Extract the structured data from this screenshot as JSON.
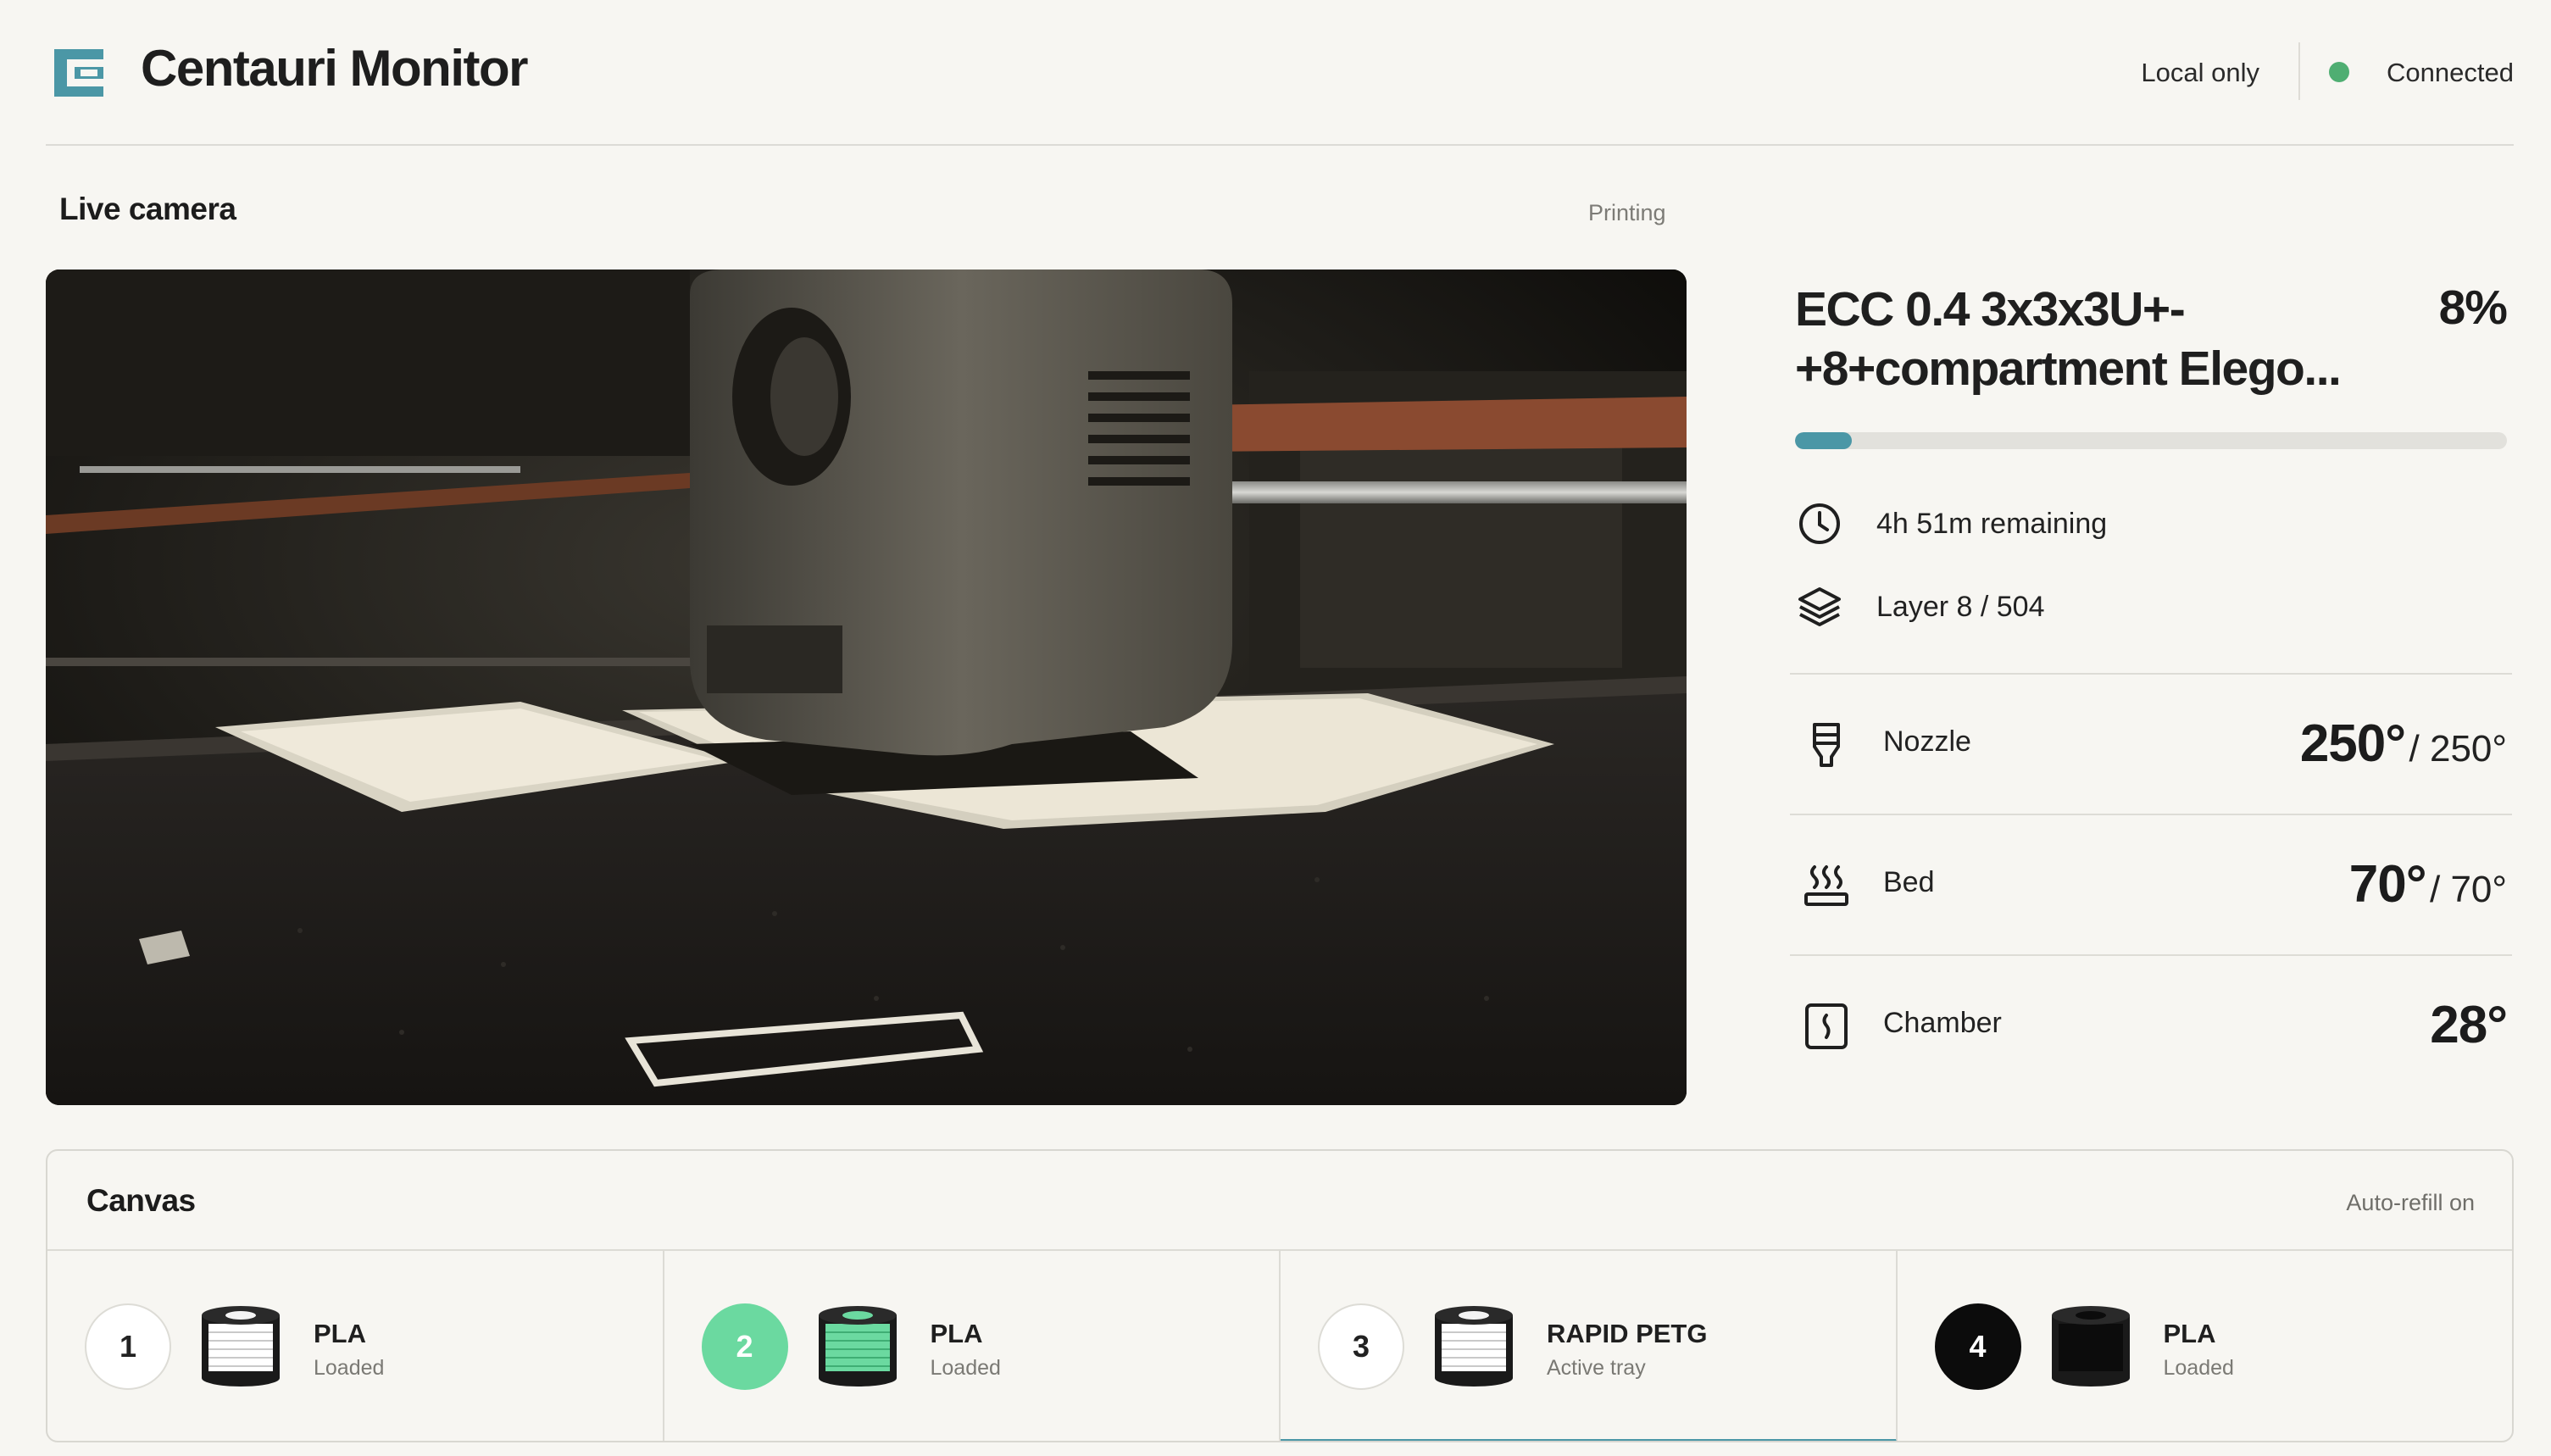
{
  "header": {
    "app_title": "Centauri Monitor",
    "mode_label": "Local only",
    "connection_label": "Connected",
    "connection_color": "#4fae72"
  },
  "camera": {
    "title": "Live camera",
    "status": "Printing"
  },
  "job": {
    "title_line1": "ECC 0.4 3x3x3U+-",
    "title_line2": "+8+compartment Elego...",
    "percent_label": "8%",
    "progress_fraction": 0.08,
    "remaining": "4h 51m remaining",
    "layer": "Layer 8 / 504"
  },
  "temps": {
    "nozzle": {
      "label": "Nozzle",
      "current": "250°",
      "target": "/ 250°",
      "icon": "nozzle-icon"
    },
    "bed": {
      "label": "Bed",
      "current": "70°",
      "target": "/ 70°",
      "icon": "heated-bed-icon"
    },
    "chamber": {
      "label": "Chamber",
      "current": "28°",
      "icon": "chamber-icon"
    }
  },
  "canvas": {
    "title": "Canvas",
    "status": "Auto-refill on",
    "trays": [
      {
        "number": "1",
        "material": "PLA",
        "state": "Loaded",
        "color": "#ffffff"
      },
      {
        "number": "2",
        "material": "PLA",
        "state": "Loaded",
        "color": "#6bd9a0"
      },
      {
        "number": "3",
        "material": "RAPID PETG",
        "state": "Active tray",
        "color": "#ffffff"
      },
      {
        "number": "4",
        "material": "PLA",
        "state": "Loaded",
        "color": "#0c0c0c"
      }
    ]
  },
  "colors": {
    "accent": "#4b97a6",
    "background": "#f7f6f2"
  }
}
